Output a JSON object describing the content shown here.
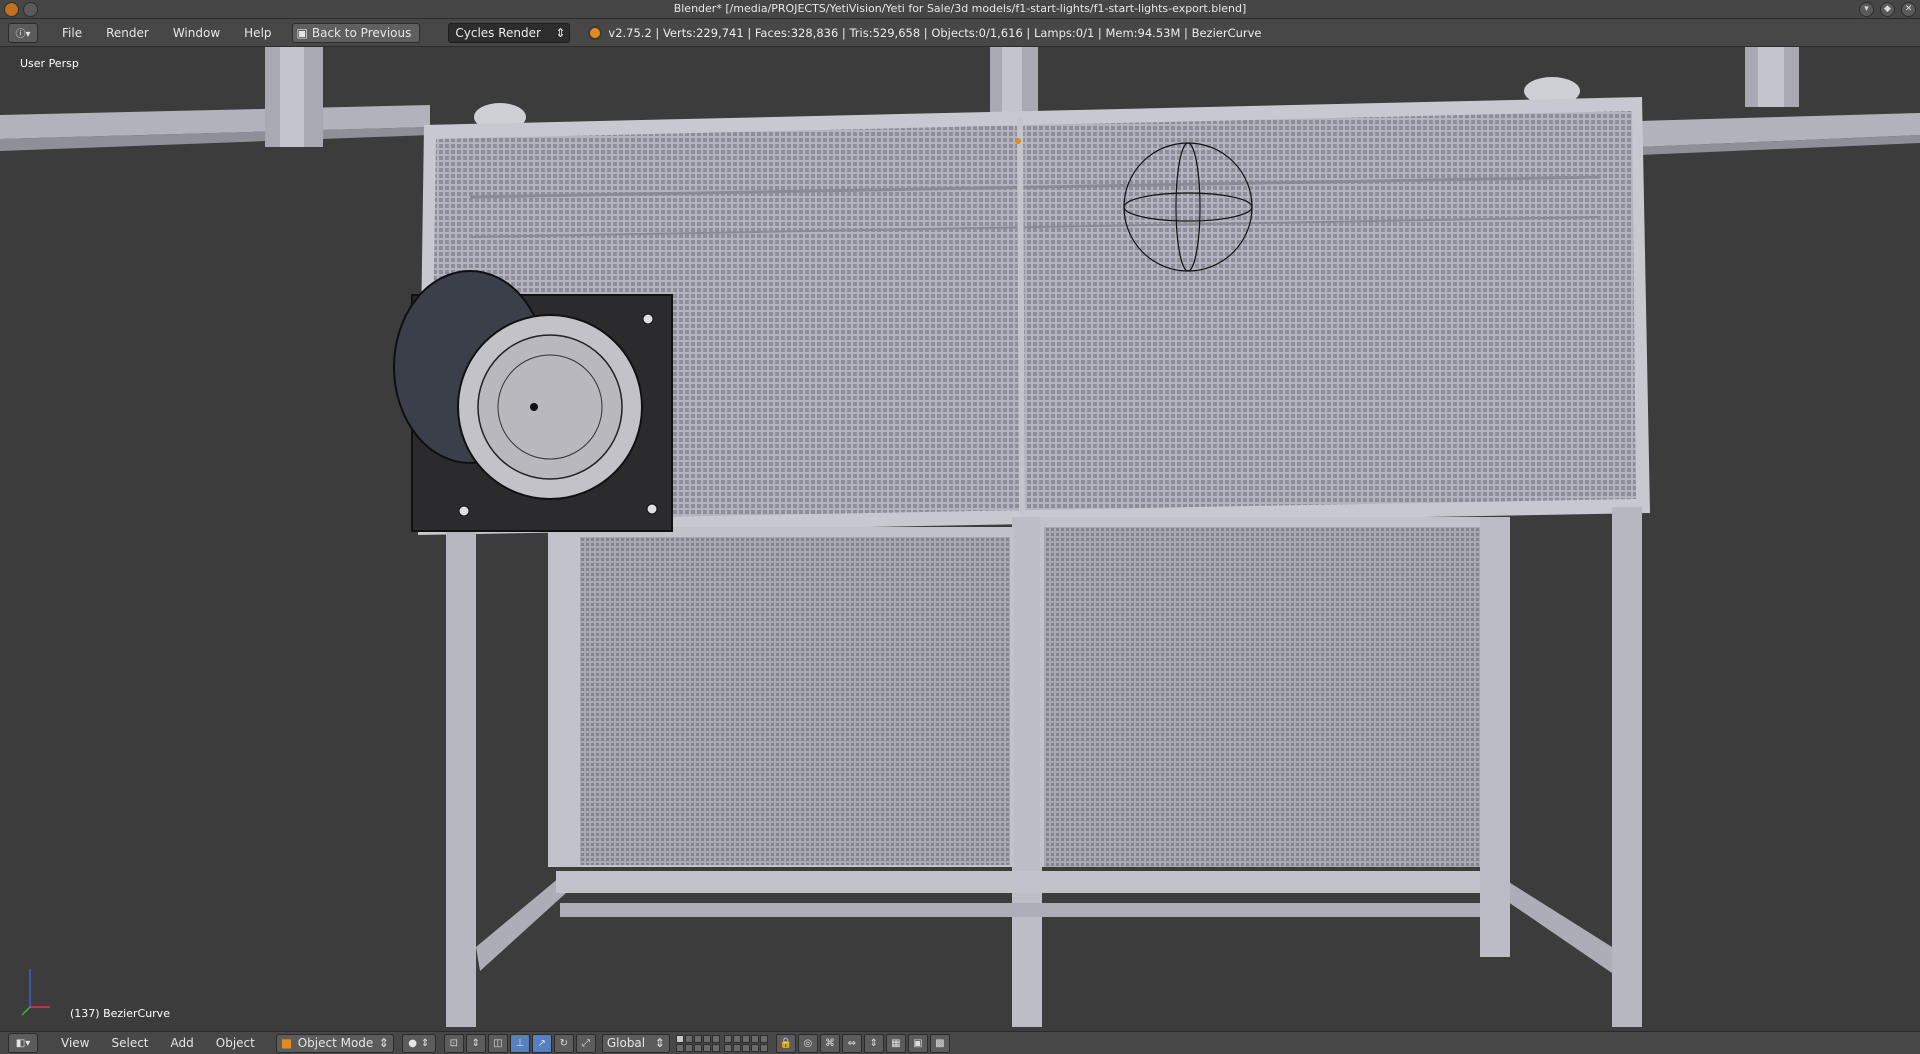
{
  "window": {
    "title": "Blender* [/media/PROJECTS/YetiVision/Yeti for Sale/3d models/f1-start-lights/f1-start-lights-export.blend]"
  },
  "info_header": {
    "menu": [
      "File",
      "Render",
      "Window",
      "Help"
    ],
    "back_button": "Back to Previous",
    "render_engine": "Cycles Render",
    "stats": "v2.75.2 | Verts:229,741 | Faces:328,836 | Tris:529,658 | Objects:0/1,616 | Lamps:0/1 | Mem:94.53M | BezierCurve"
  },
  "viewport": {
    "view_label": "User Persp",
    "object_label": "(137) BezierCurve"
  },
  "view3d_header": {
    "menu": [
      "View",
      "Select",
      "Add",
      "Object"
    ],
    "mode": "Object Mode",
    "transform_orientation": "Global"
  },
  "colors": {
    "background": "#393939",
    "header": "#474747",
    "model": "#b9b9c4",
    "active_tool": "#5680c2",
    "blender_orange": "#e08a1f"
  }
}
